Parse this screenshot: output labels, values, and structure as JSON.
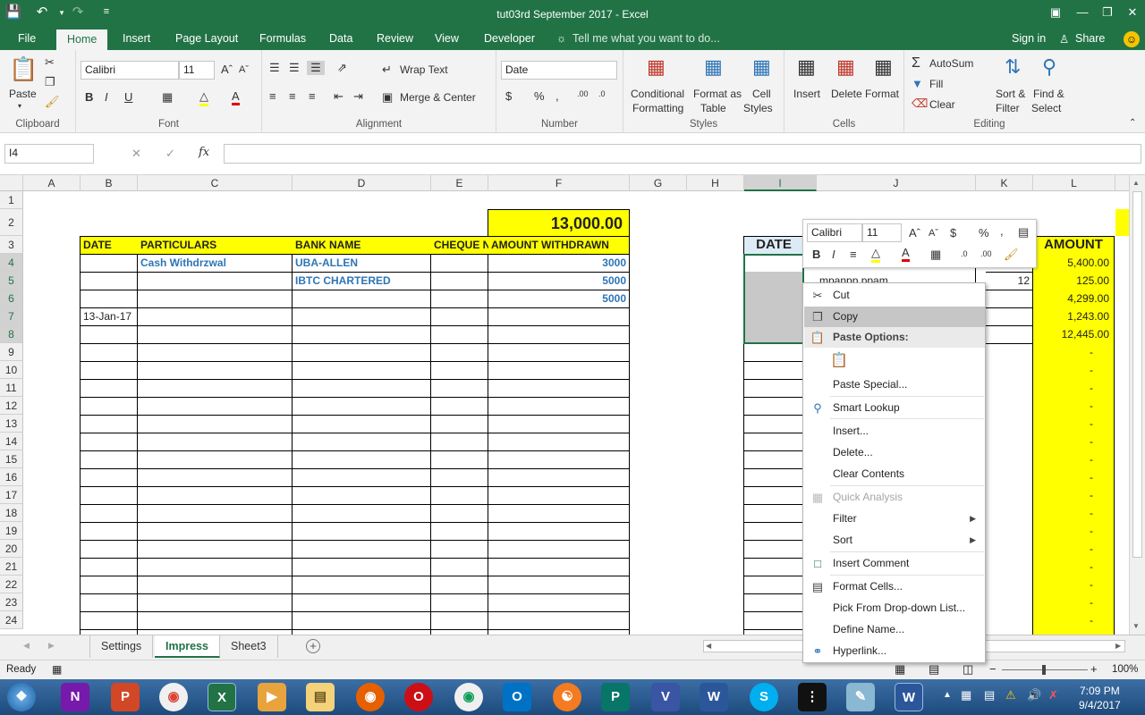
{
  "title": "tut03rd September 2017 - Excel",
  "tabs": [
    "File",
    "Home",
    "Insert",
    "Page Layout",
    "Formulas",
    "Data",
    "Review",
    "View",
    "Developer"
  ],
  "tell_me": "Tell me what you want to do...",
  "sign_in": "Sign in",
  "share": "Share",
  "ribbon": {
    "clipboard": {
      "label": "Clipboard",
      "paste": "Paste"
    },
    "font": {
      "label": "Font",
      "name": "Calibri",
      "size": "11"
    },
    "alignment": {
      "label": "Alignment",
      "wrap": "Wrap Text",
      "merge": "Merge & Center"
    },
    "number": {
      "label": "Number",
      "format": "Date"
    },
    "styles": {
      "label": "Styles",
      "cond1": "Conditional",
      "cond2": "Formatting",
      "fmt1": "Format as",
      "fmt2": "Table",
      "cell1": "Cell",
      "cell2": "Styles"
    },
    "cells": {
      "label": "Cells",
      "insert": "Insert",
      "delete": "Delete",
      "format": "Format"
    },
    "editing": {
      "label": "Editing",
      "autosum": "AutoSum",
      "fill": "Fill",
      "clear": "Clear",
      "sort1": "Sort &",
      "sort2": "Filter",
      "find1": "Find &",
      "find2": "Select"
    }
  },
  "namebox": "I4",
  "fx": "fx",
  "columns": [
    "A",
    "B",
    "C",
    "D",
    "E",
    "F",
    "G",
    "H",
    "I",
    "J",
    "K",
    "L"
  ],
  "rows": [
    "1",
    "2",
    "3",
    "4",
    "5",
    "6",
    "7",
    "8",
    "9",
    "10",
    "11",
    "12",
    "13",
    "14",
    "15",
    "16",
    "17",
    "18",
    "19",
    "20",
    "21",
    "22",
    "23",
    "24"
  ],
  "sheet": {
    "total": "13,000.00",
    "headers": {
      "date": "DATE",
      "particulars": "PARTICULARS",
      "bank": "BANK NAME",
      "cheque": "CHEQUE N",
      "amount": "AMOUNT WITHDRAWN"
    },
    "r4": {
      "particulars": "Cash Withdrzwal",
      "bank": "UBA-ALLEN",
      "amount": "3000"
    },
    "r5": {
      "bank": "IBTC CHARTERED",
      "amount": "5000"
    },
    "r6": {
      "amount": "5000"
    },
    "r7": {
      "date": "13-Jan-17"
    },
    "right_date": "DATE",
    "right_amount": "AMOUNT",
    "j5": "mpanpp.ppam",
    "k5": "12",
    "amounts": [
      "5,400.00",
      "125.00",
      "4,299.00",
      "1,243.00",
      "12,445.00"
    ],
    "dash": "-"
  },
  "mini": {
    "font": "Calibri",
    "size": "11"
  },
  "menu": {
    "cut": "Cut",
    "copy": "Copy",
    "paste_options": "Paste Options:",
    "paste_special": "Paste Special...",
    "smart": "Smart Lookup",
    "insert": "Insert...",
    "delete": "Delete...",
    "clear": "Clear Contents",
    "quick": "Quick Analysis",
    "filter": "Filter",
    "sort": "Sort",
    "comment": "Insert Comment",
    "format": "Format Cells...",
    "pick": "Pick From Drop-down List...",
    "define": "Define Name...",
    "hyperlink": "Hyperlink..."
  },
  "sheet_tabs": [
    "Settings",
    "Impress",
    "Sheet3"
  ],
  "status": {
    "ready": "Ready",
    "zoom": "100%"
  },
  "clock": {
    "time": "7:09 PM",
    "date": "9/4/2017"
  },
  "colors": {
    "excel_green": "#217346",
    "yellow": "#ffff00",
    "link_blue": "#2e75b6"
  }
}
